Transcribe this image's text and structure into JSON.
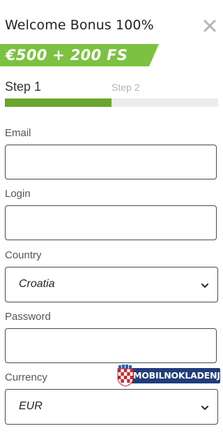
{
  "modal": {
    "title": "Welcome Bonus 100%",
    "close_icon": "close-icon"
  },
  "promo": {
    "text": "€500 + 200 FS",
    "color": "#7cc142"
  },
  "steps": {
    "current_label": "Step 1",
    "next_label": "Step 2",
    "progress_percent": 50,
    "progress_color": "#6aa52f"
  },
  "form": {
    "email": {
      "label": "Email",
      "value": ""
    },
    "login": {
      "label": "Login",
      "value": ""
    },
    "country": {
      "label": "Country",
      "selected": "Croatia",
      "icon": "chevron-down-icon"
    },
    "password": {
      "label": "Password",
      "value": ""
    },
    "currency": {
      "label": "Currency",
      "selected": "EUR",
      "icon": "chevron-down-icon"
    }
  },
  "watermark": {
    "text": "MOBILNOKLADENJE",
    "emblem": "croatian-crest-logo"
  }
}
